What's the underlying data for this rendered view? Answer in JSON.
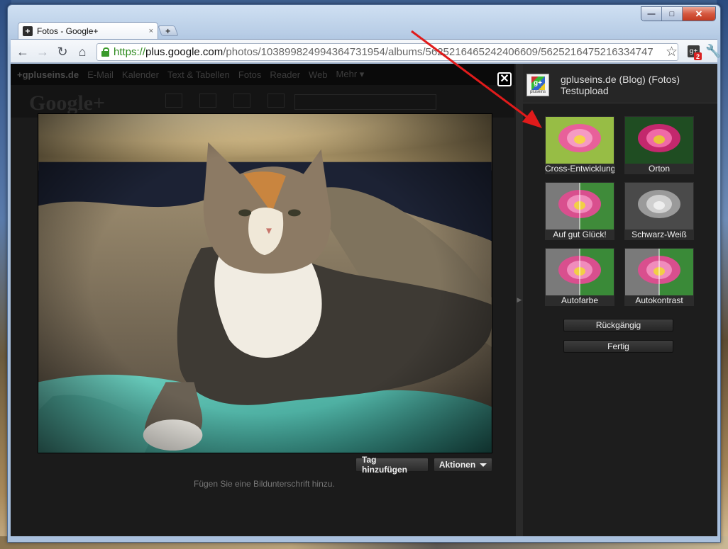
{
  "browser": {
    "tab_title": "Fotos - Google+",
    "tab_close": "×",
    "new_tab": "+",
    "url_scheme": "https://",
    "url_host": "plus.google.com",
    "url_path": "/photos/103899824994364731954/albums/5625216465242406609/5625216475216334747",
    "extension_badge": "2",
    "window_controls": {
      "minimize": "—",
      "maximize": "□",
      "close": "✕"
    }
  },
  "gbar": {
    "brand": "+gpluseins.de",
    "links": [
      "E-Mail",
      "Kalender",
      "Text & Tabellen",
      "Fotos",
      "Reader",
      "Web",
      "Mehr ▾"
    ]
  },
  "logo": "Google+",
  "viewer": {
    "close_label": "✕",
    "tag_button": "Tag hinzufügen",
    "actions_button": "Aktionen",
    "caption_placeholder": "Fügen Sie eine Bildunterschrift hinzu."
  },
  "panel": {
    "avatar_text": "pluseins",
    "title_line1": "gpluseins.de (Blog) (Fotos)",
    "title_line2": "Testupload",
    "filters": [
      {
        "label": "Cross-Entwicklung"
      },
      {
        "label": "Orton"
      },
      {
        "label": "Auf gut Glück!"
      },
      {
        "label": "Schwarz-Weiß"
      },
      {
        "label": "Autofarbe"
      },
      {
        "label": "Autokontrast"
      }
    ],
    "undo_button": "Rückgängig",
    "done_button": "Fertig"
  }
}
